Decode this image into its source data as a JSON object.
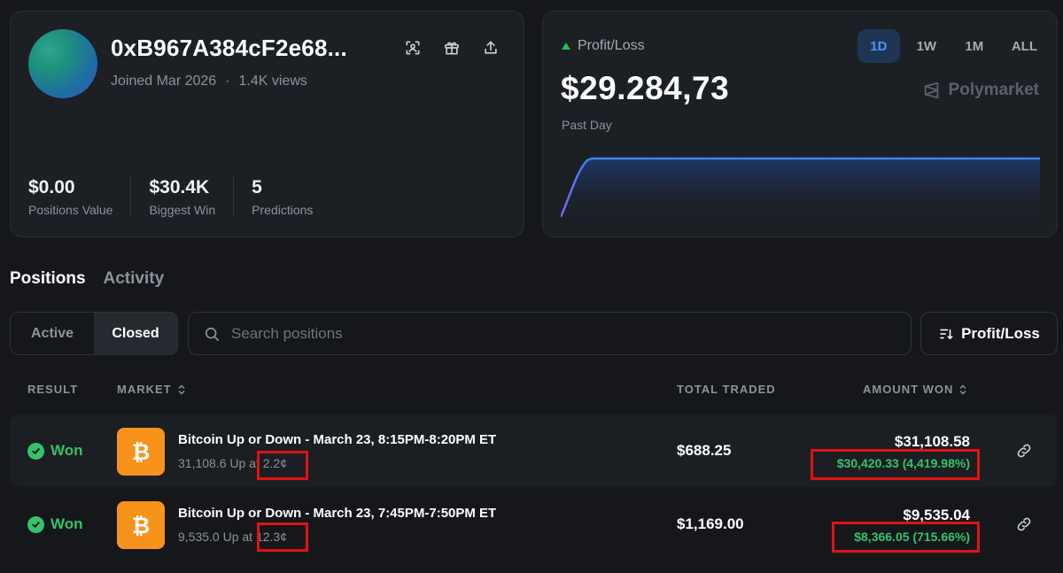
{
  "profile": {
    "username": "0xB967A384cF2e68...",
    "joined": "Joined Mar 2026",
    "separator": "·",
    "views": "1.4K views",
    "stats": [
      {
        "value": "$0.00",
        "label": "Positions Value"
      },
      {
        "value": "$30.4K",
        "label": "Biggest Win"
      },
      {
        "value": "5",
        "label": "Predictions"
      }
    ],
    "action_icons": [
      "scan-icon",
      "gift-icon",
      "share-icon"
    ]
  },
  "pnl": {
    "label": "Profit/Loss",
    "value": "$29.284,73",
    "period": "Past Day",
    "ranges": [
      "1D",
      "1W",
      "1M",
      "ALL"
    ],
    "active_range": "1D",
    "brand": "Polymarket",
    "trend_color": "#2fb85c",
    "line_color": "#3b82f6"
  },
  "tabs": {
    "positions": "Positions",
    "activity": "Activity"
  },
  "filters": {
    "active": "Active",
    "closed": "Closed",
    "search_placeholder": "Search positions",
    "sort_label": "Profit/Loss"
  },
  "table": {
    "headers": {
      "result": "RESULT",
      "market": "MARKET",
      "total": "TOTAL TRADED",
      "amount": "AMOUNT WON"
    },
    "rows": [
      {
        "result": "Won",
        "title": "Bitcoin Up or Down - March 23, 8:15PM-8:20PM ET",
        "sub_prefix": "31,108.6 Up at ",
        "sub_price": "2.2¢",
        "total": "$688.25",
        "amount": "$31,108.58",
        "gain": "$30,420.33 (4,419.98%)"
      },
      {
        "result": "Won",
        "title": "Bitcoin Up or Down - March 23, 7:45PM-7:50PM ET",
        "sub_prefix": "9,535.0 Up at ",
        "sub_price": "12.3¢",
        "total": "$1,169.00",
        "amount": "$9,535.04",
        "gain": "$8,366.05 (715.66%)"
      }
    ]
  }
}
